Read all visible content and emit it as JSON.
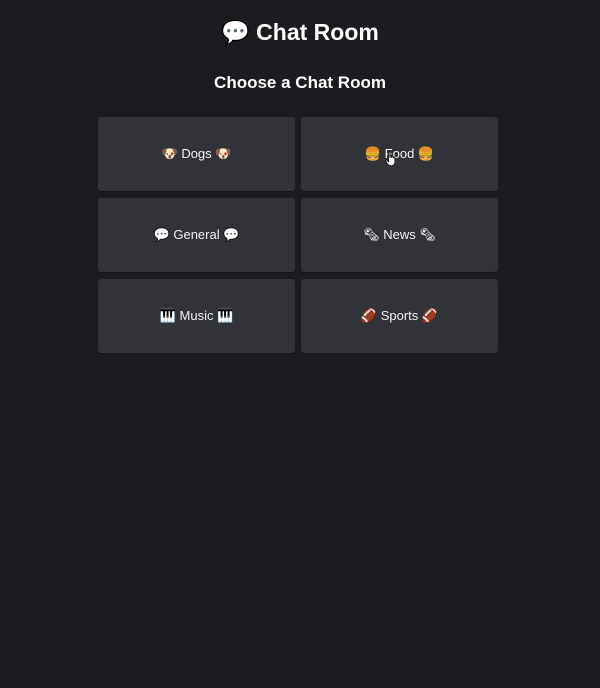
{
  "header": {
    "title": "💬 Chat Room",
    "subtitle": "Choose a Chat Room"
  },
  "rooms": [
    {
      "label": "🐶 Dogs 🐶"
    },
    {
      "label": "🍔 Food 🍔"
    },
    {
      "label": "💬 General 💬"
    },
    {
      "label": "🗞 News 🗞"
    },
    {
      "label": "🎹 Music 🎹"
    },
    {
      "label": "🏈 Sports 🏈"
    }
  ],
  "colors": {
    "background": "#1b1c20",
    "card": "#323338",
    "text": "#ffffff"
  },
  "cursor_icon": "hand-pointer-icon"
}
